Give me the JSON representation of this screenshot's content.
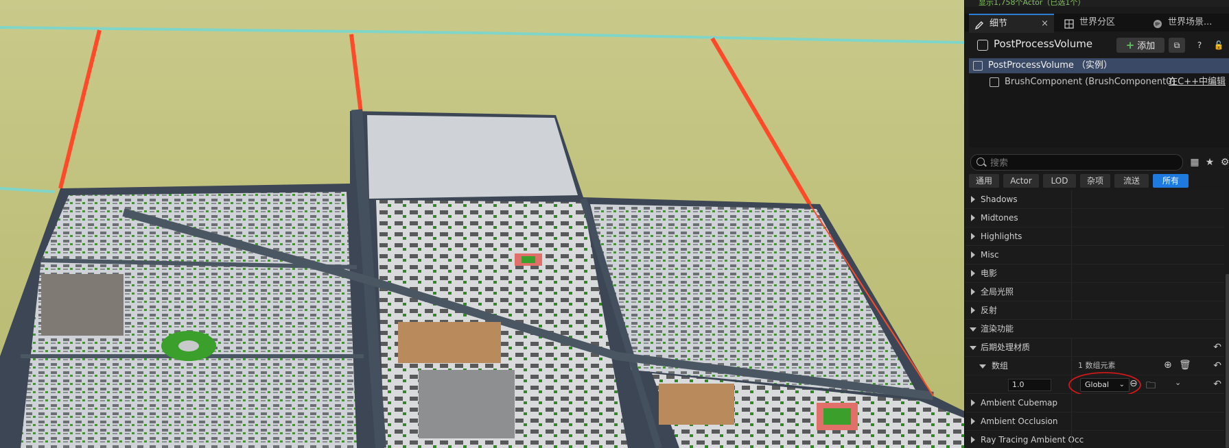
{
  "status_line": "显示1,758个Actor（已选1个）",
  "tabs": [
    {
      "label": "细节",
      "icon": "pencil-icon"
    },
    {
      "label": "世界分区",
      "icon": "grid-icon"
    },
    {
      "label": "世界场景...",
      "icon": "globe-icon"
    }
  ],
  "header": {
    "actor_name": "PostProcessVolume",
    "add_label": "添加",
    "add_color": "#5fc35f"
  },
  "tree": {
    "root_label": "PostProcessVolume （实例）",
    "child_label": "BrushComponent (BrushComponent0)",
    "edit_link": "在C++中编辑"
  },
  "search": {
    "placeholder": "搜索"
  },
  "filters": [
    "通用",
    "Actor",
    "LOD",
    "杂项",
    "流送",
    "所有"
  ],
  "active_filter_color": "#1f7ae0",
  "properties": [
    {
      "label": "Shadows"
    },
    {
      "label": "Midtones"
    },
    {
      "label": "Highlights"
    },
    {
      "label": "Misc"
    },
    {
      "label": "电影"
    },
    {
      "label": "全局光照"
    },
    {
      "label": "反射"
    },
    {
      "label": "渲染功能"
    },
    {
      "label": "后期处理材质"
    },
    {
      "label": "数组",
      "value": "1 数组元素"
    },
    {
      "label": "",
      "value": "1.0",
      "dropdown": "Global"
    },
    {
      "label": "Ambient Cubemap"
    },
    {
      "label": "Ambient Occlusion"
    },
    {
      "label": "Ray Tracing Ambient Occ"
    }
  ],
  "annotation_color": "#d01818"
}
